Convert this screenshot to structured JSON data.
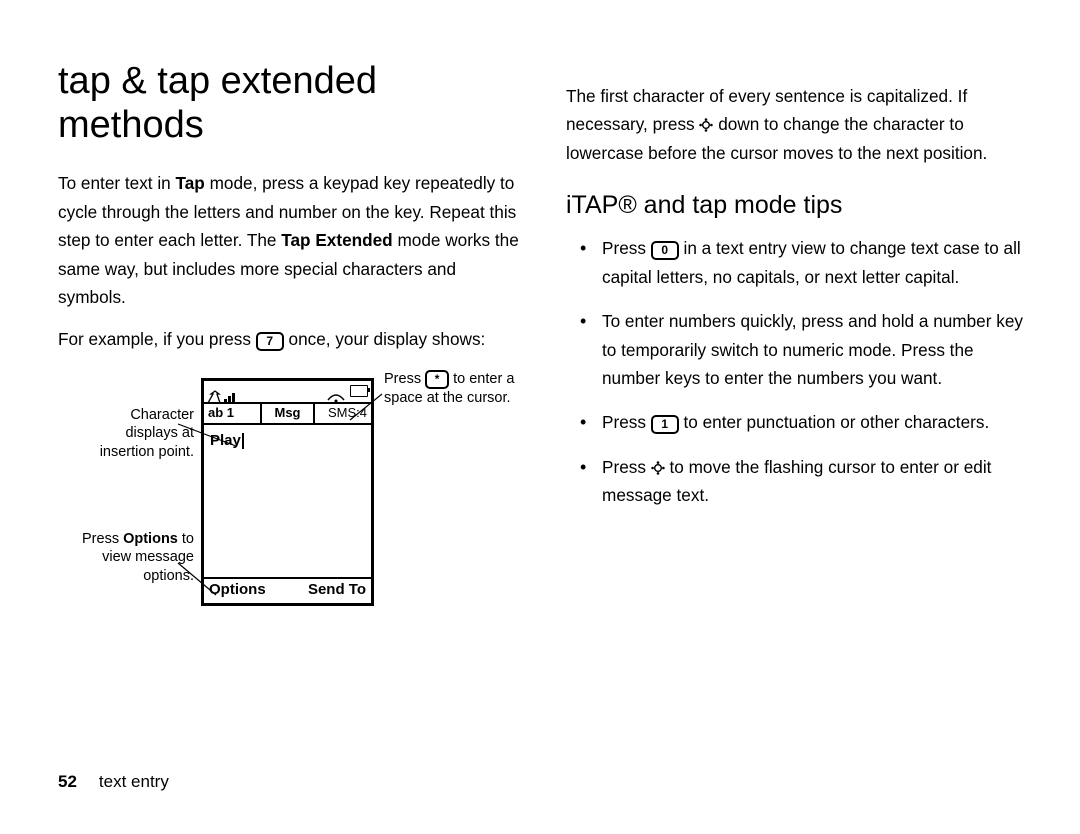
{
  "header": {
    "title": "tap & tap extended methods"
  },
  "leftCol": {
    "p1a": "To enter text in ",
    "p1_bold1": "Tap",
    "p1b": " mode, press a keypad key repeatedly to cycle through the letters and number on the key. Repeat this step to enter each letter. The ",
    "p1_bold2": "Tap Extended",
    "p1c": " mode works the same way, but includes more special characters and symbols.",
    "p2a": "For example, if you press ",
    "p2_key": "7",
    "p2b": " once, your display shows:"
  },
  "diagram": {
    "info_left": "ab 1",
    "info_mid": "Msg",
    "info_right": "SMS:4",
    "content_word": "Play",
    "soft_left": "Options",
    "soft_right": "Send To",
    "call_char": "Character displays at insertion point.",
    "call_opt_a": "Press ",
    "call_opt_bold": "Options",
    "call_opt_b": " to view message options.",
    "call_sp_a": "Press ",
    "call_sp_key": "*",
    "call_sp_b": " to enter a space at the cursor."
  },
  "rightCol": {
    "p1a": "The first character of every sentence is capitalized. If necessary, press ",
    "p1b": " down to change the character to lowercase before the cursor moves to the next position.",
    "h2": "iTAP® and tap mode tips",
    "tip1a": "Press ",
    "tip1_key": "0",
    "tip1b": " in a text entry view to change text case to all capital letters, no capitals, or next letter capital.",
    "tip2": "To enter numbers quickly, press and hold a number key to temporarily switch to numeric mode. Press the number keys to enter the numbers you want.",
    "tip3a": "Press ",
    "tip3_key": "1",
    "tip3b": " to enter punctuation or other characters.",
    "tip4a": "Press ",
    "tip4b": " to move the flashing cursor to enter or edit message text."
  },
  "footer": {
    "page": "52",
    "section": "text entry"
  }
}
